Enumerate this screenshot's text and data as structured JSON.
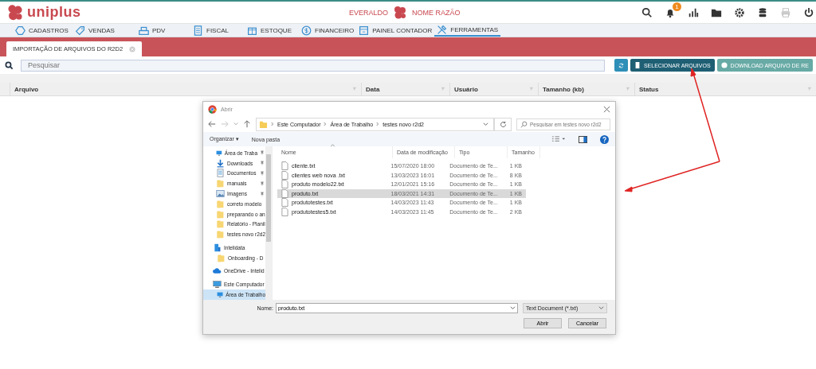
{
  "header": {
    "brand": "uniplus",
    "user": "EVERALDO",
    "company": "NOME RAZÃO",
    "notification_count": "1"
  },
  "nav": [
    {
      "label": "CADASTROS",
      "kind": "hexagon",
      "selected": false
    },
    {
      "label": "VENDAS",
      "kind": "tag",
      "selected": false
    },
    {
      "label": "PDV",
      "kind": "register",
      "selected": false
    },
    {
      "label": "FISCAL",
      "kind": "doc",
      "selected": false
    },
    {
      "label": "ESTOQUE",
      "kind": "box",
      "selected": false
    },
    {
      "label": "FINANCEIRO",
      "kind": "dollar",
      "selected": false
    },
    {
      "label": "PAINEL CONTADOR",
      "kind": "panel",
      "selected": false
    },
    {
      "label": "FERRAMENTAS",
      "kind": "tools",
      "selected": true
    }
  ],
  "tabs": [
    {
      "label": "IMPORTAÇÃO DE ARQUIVOS DO R2D2",
      "selected": true
    }
  ],
  "search": {
    "placeholder": "Pesquisar"
  },
  "buttons": [
    {
      "kind": "refresh"
    },
    {
      "kind": "primary",
      "label": "SELECIONAR ARQUIVOS"
    },
    {
      "kind": "secondary",
      "label": "DOWNLOAD ARQUIVO DE RE"
    }
  ],
  "table": {
    "columns": [
      "Arquivo",
      "Data",
      "Usuário",
      "Tamanho (kb)",
      "Status"
    ]
  },
  "dialog": {
    "title": "Abrir",
    "path": [
      "Este Computador",
      "Área de Trabalho",
      "testes novo r2d2"
    ],
    "search_placeholder": "Pesquisar em testes novo r2d2",
    "toolbar": [
      "Organizar ▾",
      "Nova pasta"
    ],
    "sidebar": [
      {
        "label": "Área de Traba",
        "kind": "monitor",
        "pinned": true,
        "selected": false
      },
      {
        "label": "Downloads",
        "kind": "download",
        "pinned": true,
        "selected": false
      },
      {
        "label": "Documentos",
        "kind": "document",
        "pinned": true,
        "selected": false
      },
      {
        "label": "manuais",
        "kind": "folder",
        "pinned": true,
        "selected": false
      },
      {
        "label": "Imagens",
        "kind": "image",
        "pinned": true,
        "selected": false
      },
      {
        "label": "correto modelo",
        "kind": "folder",
        "pinned": false,
        "selected": false
      },
      {
        "label": "preparando o an",
        "kind": "folder",
        "pinned": false,
        "selected": false
      },
      {
        "label": "Relatório - Planil",
        "kind": "folder",
        "pinned": false,
        "selected": false
      },
      {
        "label": "testes novo r2d2",
        "kind": "folder",
        "pinned": false,
        "selected": false
      },
      {
        "label": "Intelidata",
        "kind": "building",
        "pinned": false,
        "selected": false,
        "children": [
          {
            "label": "Onboarding - D",
            "kind": "folder",
            "pinned": false,
            "selected": false
          }
        ]
      },
      {
        "label": "OneDrive - Intelid",
        "kind": "cloud",
        "pinned": false,
        "selected": false
      },
      {
        "label": "Este Computador",
        "kind": "computer",
        "pinned": false,
        "selected": false,
        "children": [
          {
            "label": "Área de Trabalho",
            "kind": "monitor",
            "pinned": false,
            "selected": true
          }
        ]
      }
    ],
    "columns": [
      "Nome",
      "Data de modificação",
      "Tipo",
      "Tamanho"
    ],
    "files": [
      {
        "name": "cliente.txt",
        "date": "15/07/2020 18:00",
        "type": "Documento de Te...",
        "size": "1 KB",
        "selected": false
      },
      {
        "name": "clientes web nova .txt",
        "date": "13/03/2023 16:01",
        "type": "Documento de Te...",
        "size": "8 KB",
        "selected": false
      },
      {
        "name": "produto modelo22.txt",
        "date": "12/01/2021 15:16",
        "type": "Documento de Te...",
        "size": "1 KB",
        "selected": false
      },
      {
        "name": "produto.txt",
        "date": "18/03/2021 14:31",
        "type": "Documento de Te...",
        "size": "1 KB",
        "selected": true
      },
      {
        "name": "produtotestes.txt",
        "date": "14/03/2023 11:43",
        "type": "Documento de Te...",
        "size": "1 KB",
        "selected": false
      },
      {
        "name": "produtotestes5.txt",
        "date": "14/03/2023 11:45",
        "type": "Documento de Te...",
        "size": "2 KB",
        "selected": false
      }
    ],
    "name_label": "Nome:",
    "name_value": "produto.txt",
    "filter": "Text Document (*.txt)",
    "actions": [
      "Abrir",
      "Cancelar"
    ]
  }
}
